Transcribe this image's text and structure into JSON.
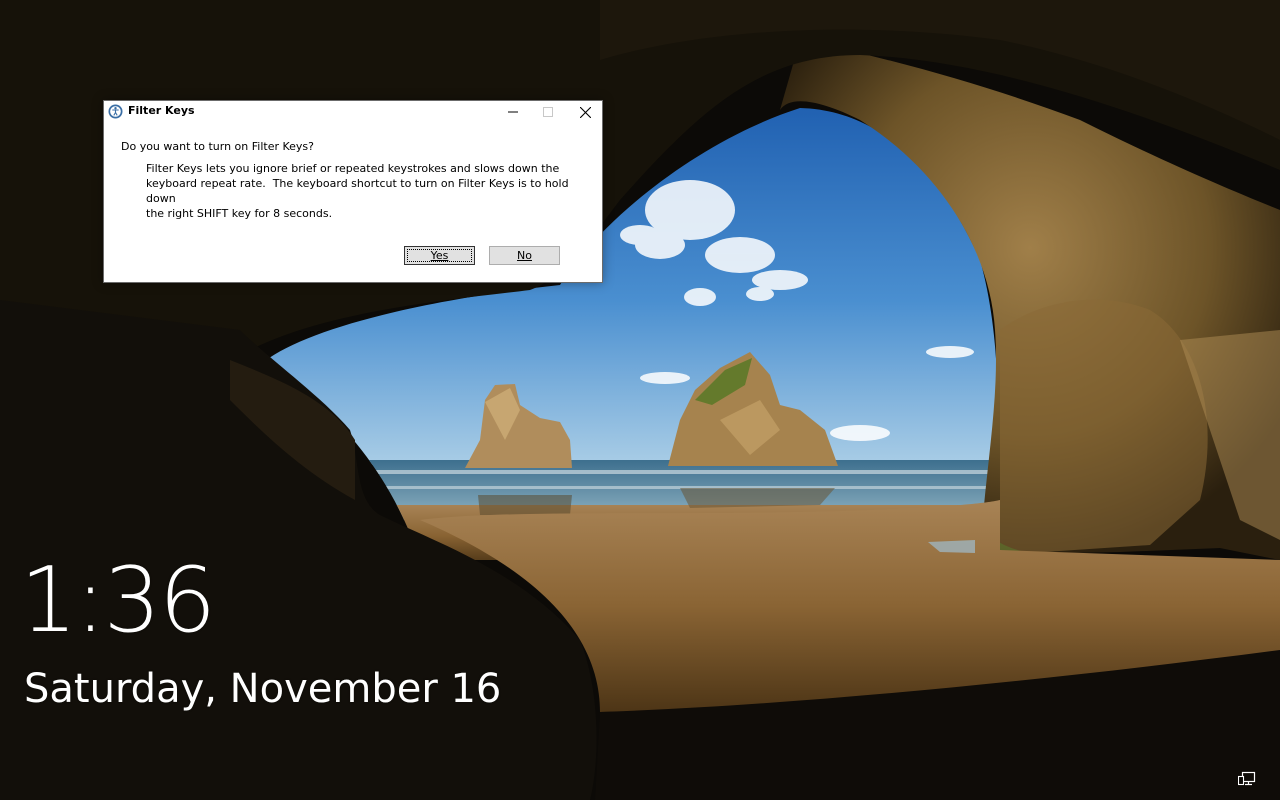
{
  "dialog": {
    "title": "Filter Keys",
    "title_icon": "ease-of-access-icon",
    "question": "Do you want to turn on Filter Keys?",
    "description": "Filter Keys lets you ignore brief or repeated keystrokes and slows down the\nkeyboard repeat rate.  The keyboard shortcut to turn on Filter Keys is to hold down\nthe right SHIFT key for 8 seconds.",
    "yes_label": "Yes",
    "no_label": "No",
    "caption_buttons": [
      "minimize-icon",
      "maximize-icon",
      "close-icon"
    ]
  },
  "lockscreen": {
    "time": "1:36",
    "date": "Saturday, November 16",
    "tray_icon": "network-icon"
  },
  "colors": {
    "dialog_bg": "#ffffff",
    "button_bg": "#e1e1e1",
    "text_light": "#ffffff"
  }
}
